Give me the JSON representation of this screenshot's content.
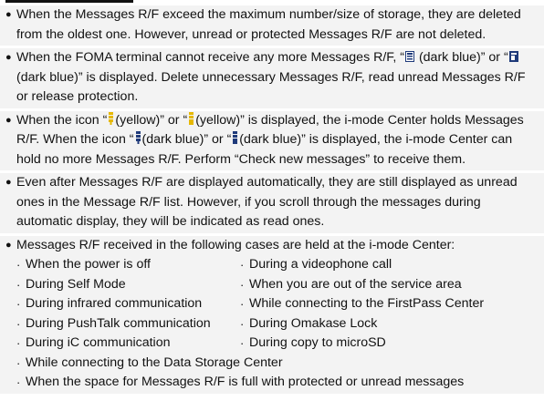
{
  "notes": [
    {
      "bullet": "●",
      "text": "When the Messages R/F exceed the maximum number/size of storage, they are deleted from the oldest one. However, unread or protected Messages R/F are not deleted."
    },
    {
      "bullet": "●",
      "segments": [
        "When the FOMA terminal cannot receive any more Messages R/F, “",
        " (dark blue)” or “",
        " (dark blue)” is displayed. Delete unnecessary Messages R/F, read unread Messages R/F or release protection."
      ],
      "icons": [
        "message-full-icon-dark-blue",
        "message-full-icon-2-dark-blue"
      ]
    },
    {
      "bullet": "●",
      "segments": [
        "When the icon “",
        "(yellow)” or “",
        "(yellow)” is displayed, the i-mode Center holds Messages R/F. When the icon “",
        "(dark blue)” or “",
        "(dark blue)” is displayed, the i-mode Center can hold no more Messages R/F. Perform “Check new messages” to receive them."
      ],
      "icons": [
        "center-holds-icon-yellow",
        "center-holds-icon-2-yellow",
        "center-full-icon-dark-blue",
        "center-full-icon-2-dark-blue"
      ]
    },
    {
      "bullet": "●",
      "text": "Even after Messages R/F are displayed automatically, they are still displayed as unread ones in the Message R/F list. However, if you scroll through the messages during automatic display, they will be indicated as read ones."
    },
    {
      "bullet": "●",
      "text": "Messages R/F received in the following cases are held at the i-mode Center:",
      "case_dot": "·",
      "cases": [
        "When the power is off",
        "During a videophone call",
        "During Self Mode",
        "When you are out of the service area",
        "During infrared communication",
        "While connecting to the FirstPass Center",
        "During PushTalk communication",
        "During Omakase Lock",
        "During iC communication",
        "During copy to microSD"
      ],
      "cases_full": [
        "While connecting to the Data Storage Center",
        "When the space for Messages R/F is full with protected or unread messages"
      ]
    }
  ],
  "colors": {
    "yellow": "#e6b800",
    "dark_blue": "#1f3a7a",
    "shade": "#f3f3f3"
  }
}
